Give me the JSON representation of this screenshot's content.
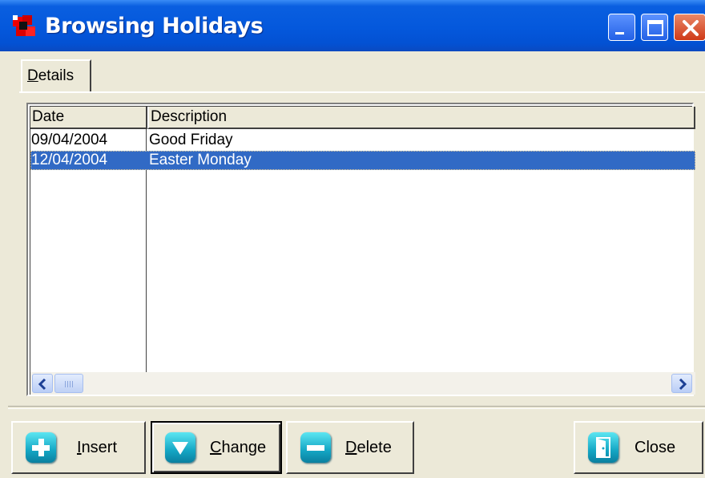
{
  "window": {
    "title": "Browsing Holidays"
  },
  "tabs": [
    {
      "label": "Details",
      "accelerator": "D",
      "rest": "etails"
    }
  ],
  "grid": {
    "columns": [
      "Date",
      "Description"
    ],
    "rows": [
      {
        "date": "09/04/2004",
        "description": "Good Friday",
        "selected": false
      },
      {
        "date": "12/04/2004",
        "description": "Easter Monday",
        "selected": true
      }
    ]
  },
  "buttons": {
    "insert": {
      "accel": "I",
      "rest": "nsert",
      "icon": "plus-icon"
    },
    "change": {
      "accel": "C",
      "rest": "hange",
      "icon": "down-arrow-icon"
    },
    "delete": {
      "accel": "D",
      "rest": "elete",
      "icon": "minus-icon"
    },
    "close": {
      "label": "Close",
      "icon": "door-icon"
    }
  },
  "colors": {
    "titlebar": "#0458dc",
    "selection": "#316ac5",
    "face": "#ece9d8",
    "button_icon": "#14a6c4"
  }
}
